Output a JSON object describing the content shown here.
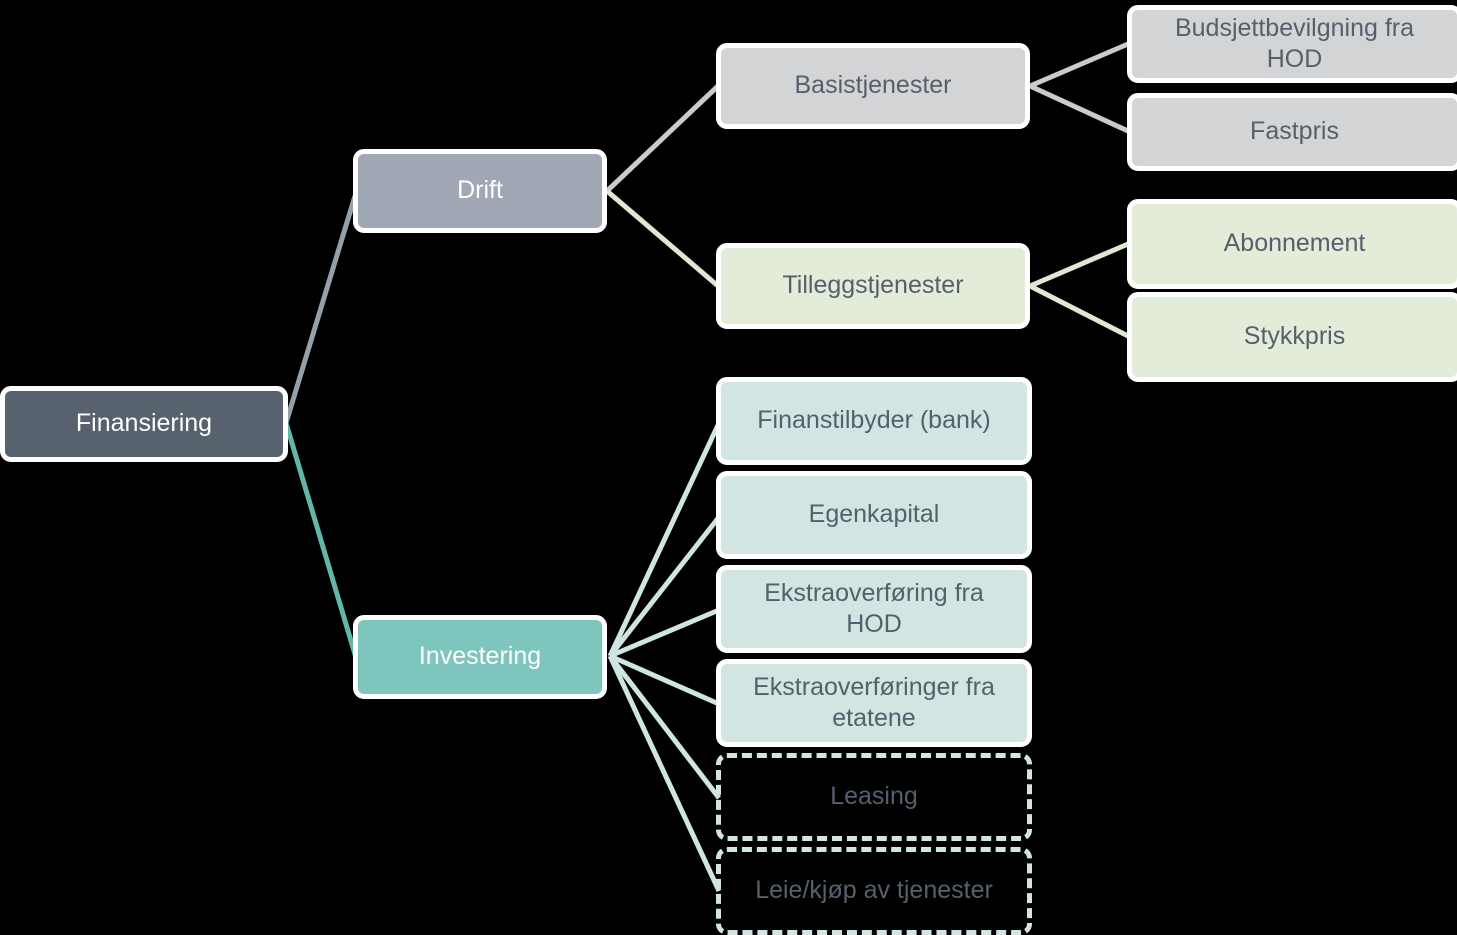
{
  "diagram": {
    "title": "Finansiering",
    "type": "tree",
    "background_color": "#000000",
    "colors": {
      "root_fill": "#57626e",
      "drift_fill": "#9fa8b4",
      "investering_fill": "#7ec5be",
      "gray_fill": "#d3d4d5",
      "green_fill": "#e3ecd9",
      "mint_fill": "#d2e5e2",
      "node_border": "#ffffff",
      "dark_text": "#56606d",
      "light_text": "#ffffff",
      "edge_gray_blue": "#95a0ad",
      "edge_teal": "#62b6ac",
      "edge_light_gray": "#c9cbcd",
      "edge_light_green": "#dfe8d2",
      "edge_light_teal": "#cfe5e1"
    },
    "nodes": {
      "finansiering": {
        "label": "Finansiering",
        "style": "root"
      },
      "drift": {
        "label": "Drift",
        "style": "drift"
      },
      "investering": {
        "label": "Investering",
        "style": "invest"
      },
      "basistjenester": {
        "label": "Basistjenester",
        "style": "gray"
      },
      "tilleggstjenester": {
        "label": "Tilleggstjenester",
        "style": "green"
      },
      "budsjettbevilgning": {
        "label": "Budsjettbevilgning fra HOD",
        "style": "gray"
      },
      "fastpris": {
        "label": "Fastpris",
        "style": "gray"
      },
      "abonnement": {
        "label": "Abonnement",
        "style": "green"
      },
      "stykkpris": {
        "label": "Stykkpris",
        "style": "green"
      },
      "finanstilbyder": {
        "label": "Finanstilbyder (bank)",
        "style": "mint"
      },
      "egenkapital": {
        "label": "Egenkapital",
        "style": "mint"
      },
      "ekstraoverforing_hod": {
        "label": "Ekstraoverføring fra\nHOD",
        "style": "mint"
      },
      "ekstraoverforinger_etatene": {
        "label": "Ekstraoverføringer fra\netatene",
        "style": "mint"
      },
      "leasing": {
        "label": "Leasing",
        "style": "dashed"
      },
      "leie_kjop": {
        "label": "Leie/kjøp av tjenester",
        "style": "dashed"
      }
    },
    "edges": [
      {
        "from": "finansiering",
        "to": "drift",
        "color": "#95a0ad"
      },
      {
        "from": "finansiering",
        "to": "investering",
        "color": "#62b6ac"
      },
      {
        "from": "drift",
        "to": "basistjenester",
        "color": "#c9cbcd"
      },
      {
        "from": "drift",
        "to": "tilleggstjenester",
        "color": "#dfe8d2"
      },
      {
        "from": "basistjenester",
        "to": "budsjettbevilgning",
        "color": "#c9cbcd"
      },
      {
        "from": "basistjenester",
        "to": "fastpris",
        "color": "#c9cbcd"
      },
      {
        "from": "tilleggstjenester",
        "to": "abonnement",
        "color": "#dfe8d2"
      },
      {
        "from": "tilleggstjenester",
        "to": "stykkpris",
        "color": "#dfe8d2"
      },
      {
        "from": "investering",
        "to": "finanstilbyder",
        "color": "#cfe5e1"
      },
      {
        "from": "investering",
        "to": "egenkapital",
        "color": "#cfe5e1"
      },
      {
        "from": "investering",
        "to": "ekstraoverforing_hod",
        "color": "#cfe5e1"
      },
      {
        "from": "investering",
        "to": "ekstraoverforinger_etatene",
        "color": "#cfe5e1"
      },
      {
        "from": "investering",
        "to": "leasing",
        "color": "#cfe5e1"
      },
      {
        "from": "investering",
        "to": "leie_kjop",
        "color": "#cfe5e1"
      }
    ]
  }
}
